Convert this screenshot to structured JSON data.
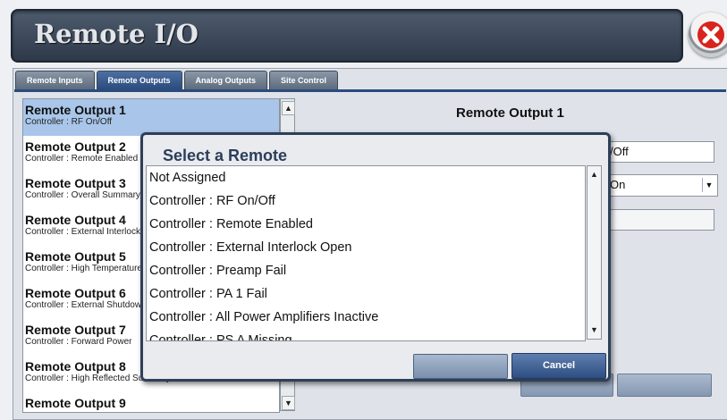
{
  "header": {
    "title": "Remote I/O"
  },
  "tabs": [
    {
      "label": "Remote Inputs"
    },
    {
      "label": "Remote Outputs"
    },
    {
      "label": "Analog Outputs"
    },
    {
      "label": "Site Control"
    }
  ],
  "outputs": [
    {
      "title": "Remote Output 1",
      "subtitle": "Controller : RF On/Off"
    },
    {
      "title": "Remote Output 2",
      "subtitle": "Controller : Remote Enabled"
    },
    {
      "title": "Remote Output 3",
      "subtitle": "Controller : Overall Summary"
    },
    {
      "title": "Remote Output 4",
      "subtitle": "Controller : External Interlock Open"
    },
    {
      "title": "Remote Output 5",
      "subtitle": "Controller : High Temperature"
    },
    {
      "title": "Remote Output 6",
      "subtitle": "Controller : External Shutdown"
    },
    {
      "title": "Remote Output 7",
      "subtitle": "Controller : Forward Power"
    },
    {
      "title": "Remote Output 8",
      "subtitle": "Controller : High Reflected Summary"
    },
    {
      "title": "Remote Output 9",
      "subtitle": ""
    }
  ],
  "detail": {
    "title": "Remote Output 1",
    "signal_value": "/Off",
    "state_value": "On"
  },
  "modal": {
    "title": "Select a Remote",
    "options": [
      "Not Assigned",
      "Controller : RF On/Off",
      "Controller : Remote Enabled",
      "Controller : External Interlock Open",
      "Controller : Preamp Fail",
      "Controller : PA 1 Fail",
      "Controller : All Power Amplifiers Inactive",
      "Controller : PS A Missing"
    ],
    "cancel_label": "Cancel"
  },
  "colors": {
    "accent": "#2b4b7d",
    "selected_row": "#a9c6ea",
    "close": "#d9231d"
  }
}
